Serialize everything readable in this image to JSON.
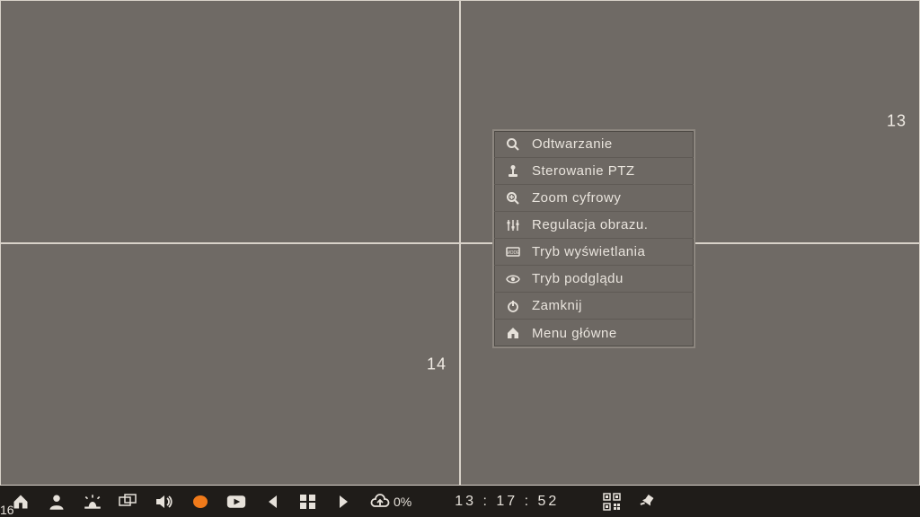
{
  "grid": {
    "cells": [
      {
        "label": ""
      },
      {
        "label": "13"
      },
      {
        "label": "14"
      },
      {
        "label": ""
      }
    ],
    "bottom_right_label": "16"
  },
  "context_menu": {
    "items": [
      {
        "icon": "search-icon",
        "label": "Odtwarzanie"
      },
      {
        "icon": "joystick-icon",
        "label": "Sterowanie PTZ"
      },
      {
        "icon": "zoom-in-icon",
        "label": "Zoom cyfrowy"
      },
      {
        "icon": "sliders-icon",
        "label": "Regulacja obrazu."
      },
      {
        "icon": "display-mode-icon",
        "label": "Tryb wyświetlania"
      },
      {
        "icon": "eye-icon",
        "label": "Tryb podglądu"
      },
      {
        "icon": "power-icon",
        "label": "Zamknij"
      },
      {
        "icon": "home-icon",
        "label": "Menu główne"
      }
    ]
  },
  "toolbar": {
    "cloud_percent": "0%",
    "clock": "13 : 17 : 52"
  }
}
